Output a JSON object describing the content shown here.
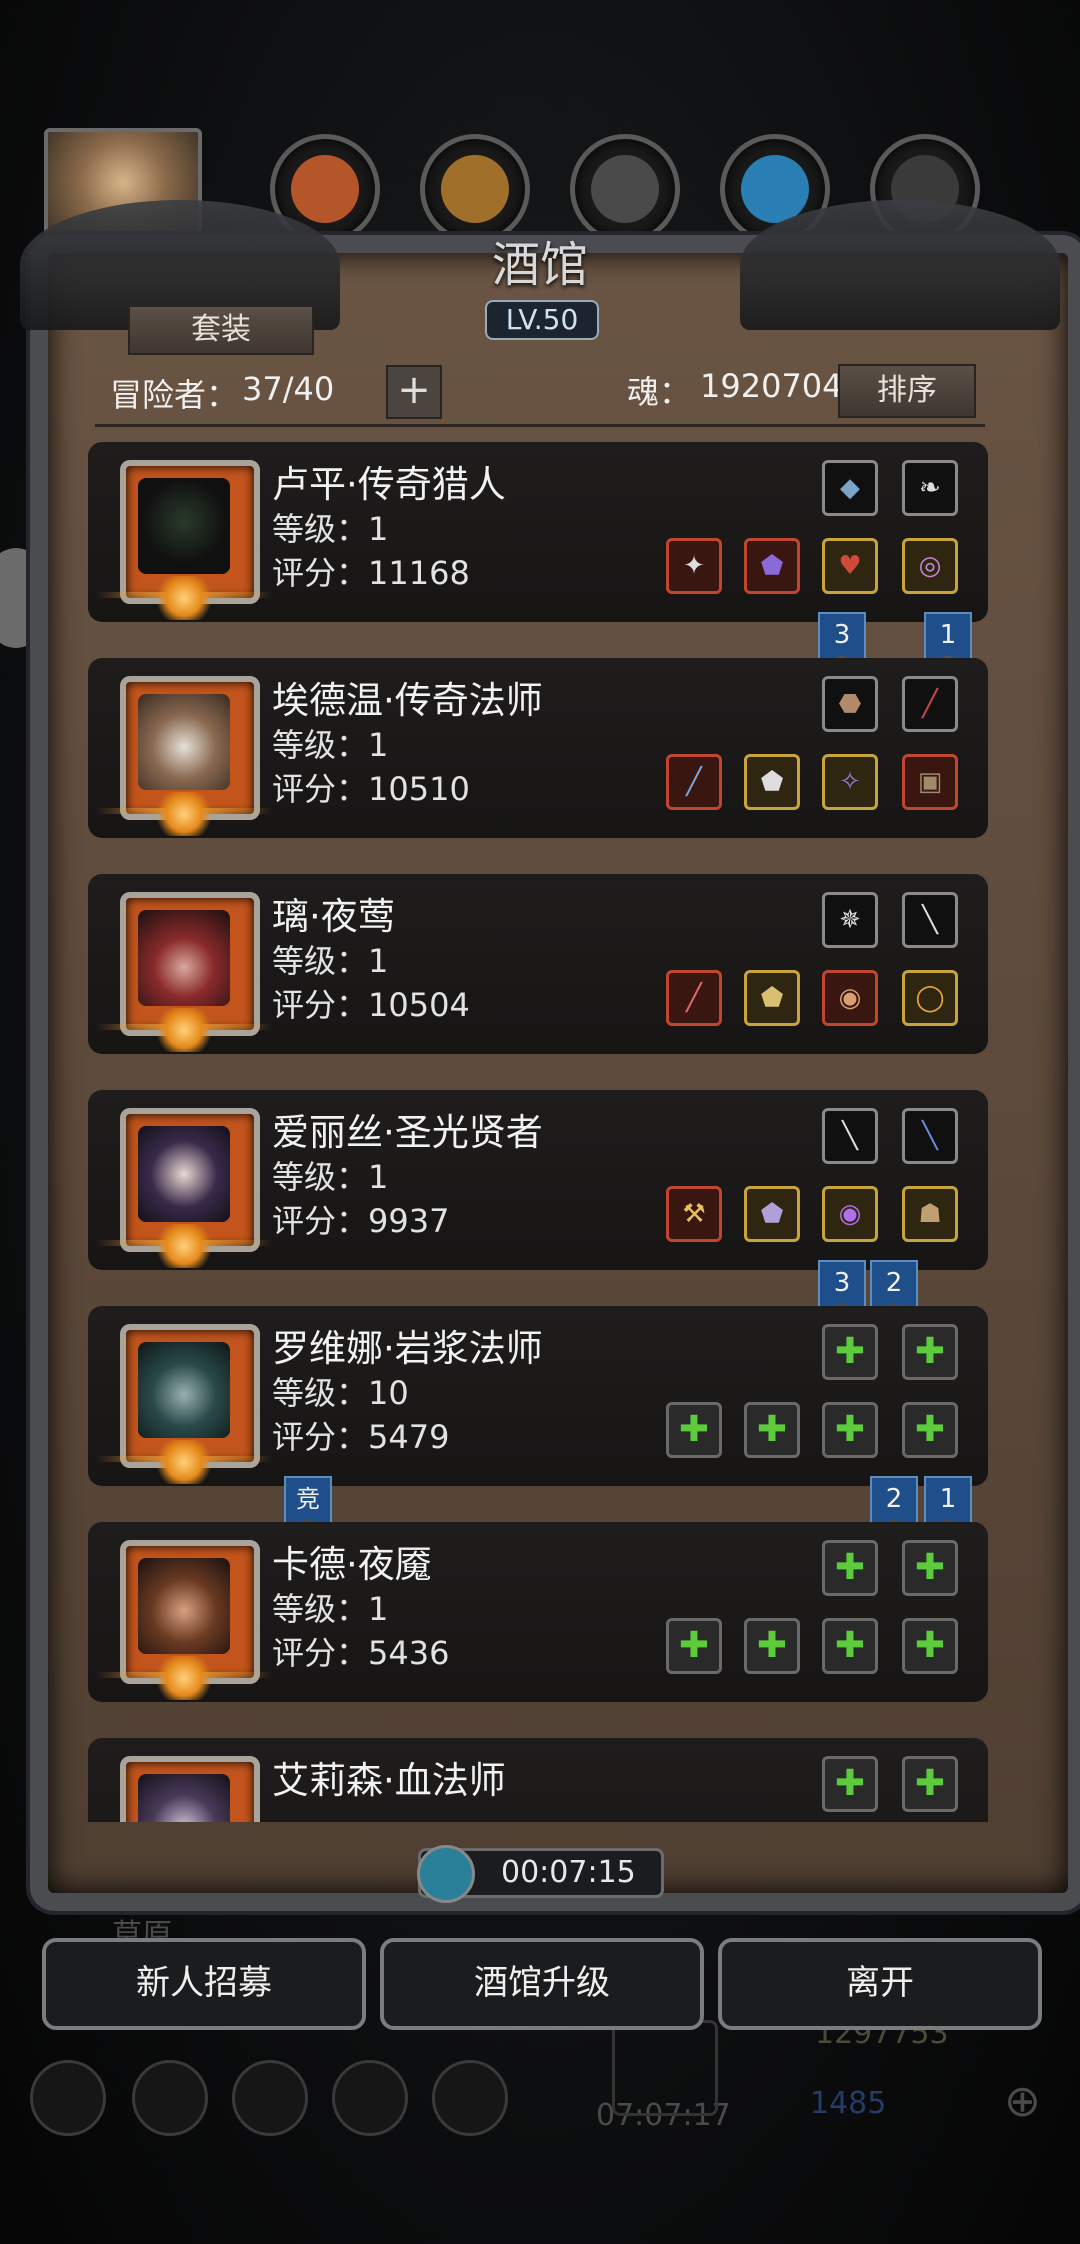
{
  "window": {
    "title": "酒馆",
    "level_badge": "LV.50"
  },
  "header": {
    "set_button": "套装",
    "adventurers_label": "冒险者：",
    "adventurers_value": "37/40",
    "add_button": "+",
    "soul_label": "魂：",
    "soul_value": "1920704",
    "sort_button": "排序"
  },
  "heroes": [
    {
      "name": "卢平·传奇猎人",
      "level": "等级：1",
      "score": "评分：11168"
    },
    {
      "name": "埃德温·传奇法师",
      "level": "等级：1",
      "score": "评分：10510"
    },
    {
      "name": "璃·夜莺",
      "level": "等级：1",
      "score": "评分：10504"
    },
    {
      "name": "爱丽丝·圣光贤者",
      "level": "等级：1",
      "score": "评分：9937"
    },
    {
      "name": "罗维娜·岩浆法师",
      "level": "等级：10",
      "score": "评分：5479"
    },
    {
      "name": "卡德·夜魇",
      "level": "等级：1",
      "score": "评分：5436"
    },
    {
      "name": "艾莉森·血法师",
      "level": "",
      "score": ""
    }
  ],
  "flags": {
    "row1_a": "3",
    "row1_b": "1",
    "row4_a": "3",
    "row4_b": "2",
    "row5_left": "竞",
    "row5_a": "2",
    "row5_b": "1"
  },
  "timer": {
    "value": "00:07:15"
  },
  "footer_buttons": {
    "recruit": "新人招募",
    "upgrade": "酒馆升级",
    "leave": "离开"
  },
  "background_ui": {
    "left_label": "草原",
    "gold": "1297753",
    "gems": "1485",
    "clock": "07:07:17"
  },
  "colors": {
    "frame": "#4a4c50",
    "panel": "#5d4a3b",
    "flag": "#1f4f8a",
    "slot_red": "#c0462e",
    "slot_gold": "#c7a43c",
    "plus_green": "#5ccb3c"
  }
}
